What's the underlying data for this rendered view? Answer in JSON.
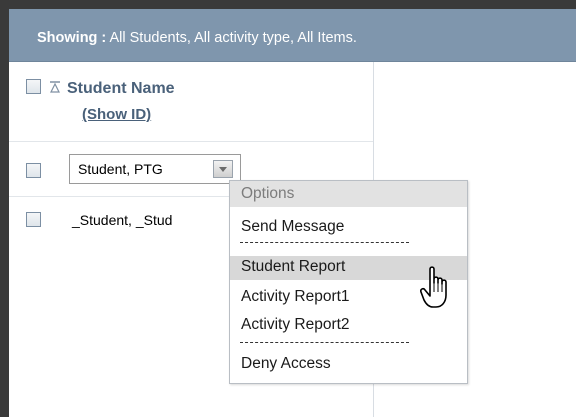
{
  "header": {
    "showing_label": "Showing :",
    "showing_value": " All Students, All activity type, All Items."
  },
  "table": {
    "column_title": "Student Name",
    "show_id_link": "(Show ID)",
    "rows": [
      {
        "name": "Student, PTG"
      },
      {
        "name": "_Student, _Stud"
      }
    ]
  },
  "menu": {
    "title": "Options",
    "items": [
      {
        "label": "Send Message"
      },
      {
        "label": "Student Report"
      },
      {
        "label": "Activity Report1"
      },
      {
        "label": "Activity Report2"
      },
      {
        "label": "Deny Access"
      }
    ],
    "hovered": "Student Report"
  },
  "icons": {
    "sort": "sort-ascending-icon",
    "dropdown": "chevron-down-icon",
    "cursor": "hand-pointer-icon"
  },
  "colors": {
    "header_bg": "#7f96ad",
    "header_text": "#ffffff",
    "link": "#4a617a",
    "menu_title_bg": "#e2e2e2",
    "menu_hover_bg": "#d8d8d8"
  }
}
